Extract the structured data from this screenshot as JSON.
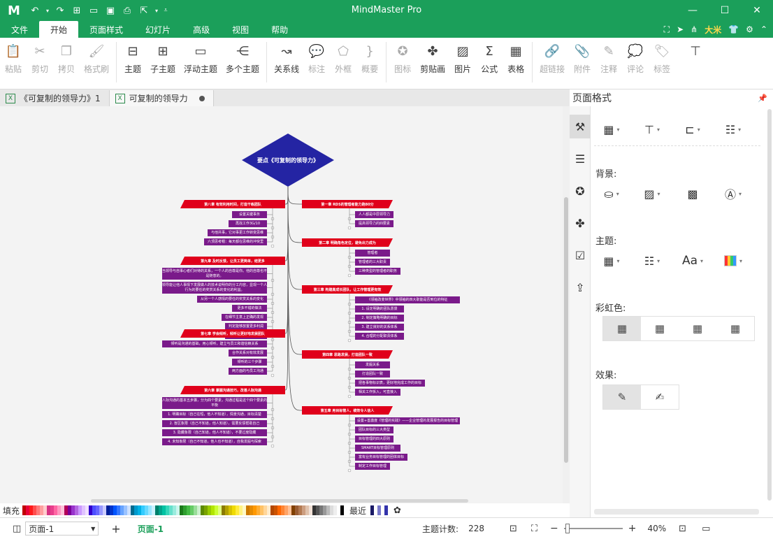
{
  "app": {
    "title": "MindMaster Pro",
    "logo": "M",
    "user": "大米"
  },
  "menu": {
    "tabs": [
      "文件",
      "开始",
      "页面样式",
      "幻灯片",
      "高级",
      "视图",
      "帮助"
    ],
    "active": "开始"
  },
  "ribbon": {
    "buttons": [
      {
        "label": "粘贴",
        "icon": "clipboard-icon",
        "disabled": true
      },
      {
        "label": "剪切",
        "icon": "scissors-icon",
        "disabled": true
      },
      {
        "label": "拷贝",
        "icon": "copy-icon",
        "disabled": true
      },
      {
        "label": "格式刷",
        "icon": "format-brush-icon",
        "disabled": true
      },
      {
        "label": "主题",
        "icon": "topic-icon",
        "disabled": false
      },
      {
        "label": "子主题",
        "icon": "subtopic-icon",
        "disabled": false
      },
      {
        "label": "浮动主题",
        "icon": "floating-topic-icon",
        "disabled": false
      },
      {
        "label": "多个主题",
        "icon": "multiple-topics-icon",
        "disabled": false
      },
      {
        "label": "关系线",
        "icon": "relation-line-icon",
        "disabled": false
      },
      {
        "label": "标注",
        "icon": "callout-icon",
        "disabled": true
      },
      {
        "label": "外框",
        "icon": "boundary-icon",
        "disabled": true
      },
      {
        "label": "概要",
        "icon": "summary-icon",
        "disabled": true
      },
      {
        "label": "图标",
        "icon": "mark-icon",
        "disabled": true
      },
      {
        "label": "剪贴画",
        "icon": "clipart-icon",
        "disabled": false
      },
      {
        "label": "图片",
        "icon": "picture-icon",
        "disabled": false
      },
      {
        "label": "公式",
        "icon": "formula-icon",
        "disabled": false
      },
      {
        "label": "表格",
        "icon": "table-icon",
        "disabled": false
      },
      {
        "label": "超链接",
        "icon": "hyperlink-icon",
        "disabled": true
      },
      {
        "label": "附件",
        "icon": "attachment-icon",
        "disabled": true
      },
      {
        "label": "注释",
        "icon": "note-icon",
        "disabled": true
      },
      {
        "label": "评论",
        "icon": "comment-icon",
        "disabled": true
      },
      {
        "label": "标签",
        "icon": "tag-icon",
        "disabled": true
      }
    ]
  },
  "doc_tabs": [
    {
      "label": "《可复制的领导力》1",
      "active": false
    },
    {
      "label": "可复制的领导力",
      "active": true
    }
  ],
  "mindmap": {
    "root": "要点《可复制的领导力》",
    "left": [
      {
        "title": "第八章 有效利用时间，打造干练团队",
        "items": [
          "设置关键事务",
          "再找工作3G/10",
          "与他共事，它对事更工作转变思维",
          "六顶思考帽：每天都在思维的冲突里"
        ]
      },
      {
        "title": "第九章 及时反馈，让员工更简单，结更多",
        "items": [
          "当领导与自事心者们对待的关系，一个人的自尊是你。他的自尊也不是随意的。",
          "领导能让他人事情下发展做人的技术说明你的分工内容，显现一个人行为的要任的奖赏关系的变化的利益。",
          "从另一个人感情的要任的奖赏关系的变化",
          "更多不错的做法",
          "在细节主意上正确的发现",
          "判定能够放置更多利润",
          "利时调整做管理性更多"
        ]
      },
      {
        "title": "第七章 学会倾听，倾听让更好地发展团队",
        "items": [
          "倾听是沟通的基础，用心倾听，建立与员工和谐信赖关系",
          "合作关系对有效发展",
          "倾听的三个步骤",
          "两方面的与员工沟通"
        ]
      },
      {
        "title": "第六章 掌握沟通技巧，改善人际沟通",
        "items": [
          "人际沟通的基本五步骤，分为四个要素，沟通过程是这个四个要素的平衡",
          "1. 明确目标（自己在短，他人不知道），情景沟通，目标清楚",
          "2. 盲区象限（自己不知道，他人知道），需要反馈帮助自己",
          "3. 隐藏象限（自己知道，他人不知道），不要过度隐藏",
          "4. 未知象限（自己不知道，他人也不知道），自我发掘与探索"
        ]
      }
    ],
    "right": [
      {
        "title": "第一章 RDS的管理者能力跑80分",
        "items": [
          "人人都是中层领导力",
          "提高领导力的四要素"
        ]
      },
      {
        "title": "第二章 明确角色定位，避免出力成为",
        "items": [
          "管理者",
          "管理者的三大职责",
          "三种类型的管理者的职务"
        ]
      },
      {
        "title": "第三章 构建高成长团队，让工作管理更有效",
        "items": [
          "《领袖改变世界》中领袖的四大职能是否到位的特征",
          "1. 设定明确的团队愿景",
          "2. 制定策略明确的目标",
          "3. 建立良好的关系体系",
          "4. 合理的分配职责体系"
        ]
      },
      {
        "title": "第四章 思路发展，打造团队一致",
        "items": [
          "发掘关系",
          "打造团队一致",
          "把各事物标识表，更好地完成工作的目标",
          "相关工作拆入，可直接入"
        ]
      },
      {
        "title": "第五章 用目标管人，绩效令人信人",
        "items": [
          "设置+善激度《管理的实践》——企业管理的发展报告的目标管理",
          "团队目标的三大类型",
          "目标管理的四大原则",
          "SMART目标管理原则",
          "富有业务目标管理的团体目标",
          "制定工作目标管理"
        ]
      }
    ]
  },
  "panel": {
    "title": "页面格式",
    "background_label": "背景:",
    "theme_label": "主题:",
    "rainbow_label": "彩虹色:",
    "effect_label": "效果:"
  },
  "palette": {
    "fill_label": "填充",
    "recent_label": "最近",
    "colors": [
      "#c00000",
      "#e8003a",
      "#ff1a1a",
      "#ff4d4d",
      "#ff7a7a",
      "#ff9f9f",
      "#ffcccc",
      "#d63384",
      "#e83e8c",
      "#ff66a3",
      "#ff99c2",
      "#ffc2da",
      "#b30059",
      "#7a0099",
      "#9933cc",
      "#b366e0",
      "#cc99ff",
      "#e0c2ff",
      "#f0e0ff",
      "#3300cc",
      "#4d4dff",
      "#6666ff",
      "#9999ff",
      "#ccccff",
      "#001f99",
      "#0033cc",
      "#0055ff",
      "#3377ff",
      "#66a3ff",
      "#99c2ff",
      "#cce0ff",
      "#006b8f",
      "#0099cc",
      "#00b3e6",
      "#33ccff",
      "#66d9ff",
      "#99e6ff",
      "#ccf2ff",
      "#00806b",
      "#00a38a",
      "#00c2a3",
      "#33d6b8",
      "#66e0cc",
      "#99ebdd",
      "#ccf5ee",
      "#1a7a1a",
      "#2e9e2e",
      "#44bb44",
      "#66cc66",
      "#99dd99",
      "#ccf0cc",
      "#5c8a00",
      "#7aa300",
      "#99cc00",
      "#b3e600",
      "#ccff33",
      "#e0ff80",
      "#8a7a00",
      "#b3a100",
      "#d6c200",
      "#f0db00",
      "#ffeb3b",
      "#fff380",
      "#fff9c4",
      "#cc7a00",
      "#e68a00",
      "#ff9900",
      "#ffad33",
      "#ffc266",
      "#ffd699",
      "#ffebcc",
      "#b34700",
      "#cc5200",
      "#ff6600",
      "#ff8533",
      "#ffa366",
      "#ffc299",
      "#804000",
      "#995c33",
      "#b37a52",
      "#cc9e80",
      "#e0c2ad",
      "#f0e0d6",
      "#333333",
      "#555555",
      "#777777",
      "#999999",
      "#bbbbbb",
      "#dddddd",
      "#eeeeee",
      "#ffffff",
      "#000000"
    ],
    "recent_colors": [
      "#1a1a66",
      "#ffffff",
      "#7a7acc",
      "#ffffff",
      "#3333aa"
    ]
  },
  "status": {
    "page_select": "页面-1",
    "current_page": "页面-1",
    "topic_count_label": "主题计数:",
    "topic_count": "228",
    "zoom": "40%"
  },
  "colors": {
    "brand": "#1b9f5a",
    "root": "#2424a3",
    "branch": "#e0001b",
    "leaf": "#7a1a8a"
  }
}
